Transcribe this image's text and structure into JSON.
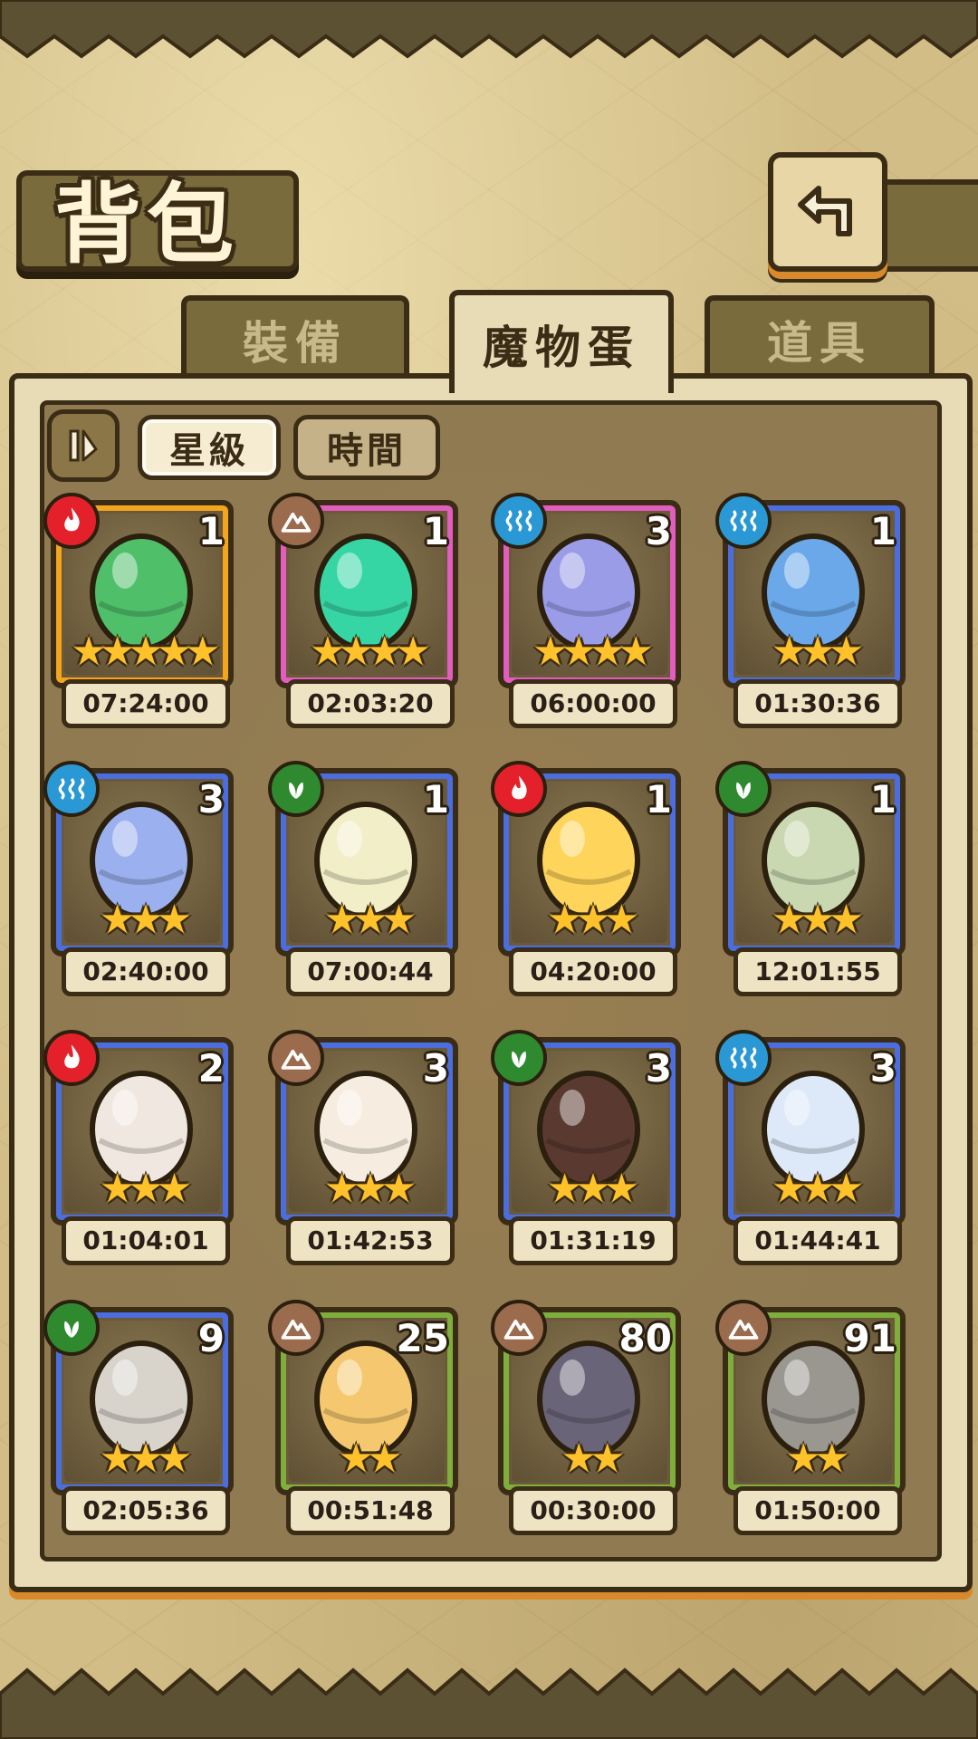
{
  "title": "背包",
  "tabs": [
    {
      "label": "裝備",
      "active": false
    },
    {
      "label": "魔物蛋",
      "active": true
    },
    {
      "label": "道具",
      "active": false
    }
  ],
  "sort": {
    "toggle_icon": "sort-order-icon",
    "star_label": "星級",
    "time_label": "時間",
    "active": "星級"
  },
  "colors": {
    "frame_gold": "#f3a51e",
    "frame_pink": "#e35cc0",
    "frame_blue": "#4a6ee0",
    "frame_green": "#7fae3c",
    "fire": "#e4212b",
    "earth": "#9b6b4d",
    "water": "#2a98d4",
    "wood": "#2f8a2f",
    "star": "#ffc22a"
  },
  "eggs": [
    {
      "element": "fire",
      "count": "1",
      "stars": 5,
      "timer": "07:24:00",
      "frame": "gold",
      "egg_color": "#4fbf6a"
    },
    {
      "element": "earth",
      "count": "1",
      "stars": 4,
      "timer": "02:03:20",
      "frame": "pink",
      "egg_color": "#36d6a4"
    },
    {
      "element": "water",
      "count": "3",
      "stars": 4,
      "timer": "06:00:00",
      "frame": "pink",
      "egg_color": "#9a9ce8"
    },
    {
      "element": "water",
      "count": "1",
      "stars": 3,
      "timer": "01:30:36",
      "frame": "blue",
      "egg_color": "#6aa8ea"
    },
    {
      "element": "water",
      "count": "3",
      "stars": 3,
      "timer": "02:40:00",
      "frame": "blue",
      "egg_color": "#9bb0ee"
    },
    {
      "element": "wood",
      "count": "1",
      "stars": 3,
      "timer": "07:00:44",
      "frame": "blue",
      "egg_color": "#f2eec8"
    },
    {
      "element": "fire",
      "count": "1",
      "stars": 3,
      "timer": "04:20:00",
      "frame": "blue",
      "egg_color": "#ffd45a"
    },
    {
      "element": "wood",
      "count": "1",
      "stars": 3,
      "timer": "12:01:55",
      "frame": "blue",
      "egg_color": "#c9d8b0"
    },
    {
      "element": "fire",
      "count": "2",
      "stars": 3,
      "timer": "01:04:01",
      "frame": "blue",
      "egg_color": "#f0e8e0"
    },
    {
      "element": "earth",
      "count": "3",
      "stars": 3,
      "timer": "01:42:53",
      "frame": "blue",
      "egg_color": "#f6ede0"
    },
    {
      "element": "wood",
      "count": "3",
      "stars": 3,
      "timer": "01:31:19",
      "frame": "blue",
      "egg_color": "#5a3a30"
    },
    {
      "element": "water",
      "count": "3",
      "stars": 3,
      "timer": "01:44:41",
      "frame": "blue",
      "egg_color": "#dde8f8"
    },
    {
      "element": "wood",
      "count": "9",
      "stars": 3,
      "timer": "02:05:36",
      "frame": "blue",
      "egg_color": "#d8d4cc"
    },
    {
      "element": "earth",
      "count": "25",
      "stars": 2,
      "timer": "00:51:48",
      "frame": "green",
      "egg_color": "#f5c870"
    },
    {
      "element": "earth",
      "count": "80",
      "stars": 2,
      "timer": "00:30:00",
      "frame": "green",
      "egg_color": "#6a6478"
    },
    {
      "element": "earth",
      "count": "91",
      "stars": 2,
      "timer": "01:50:00",
      "frame": "green",
      "egg_color": "#9a9690"
    }
  ]
}
